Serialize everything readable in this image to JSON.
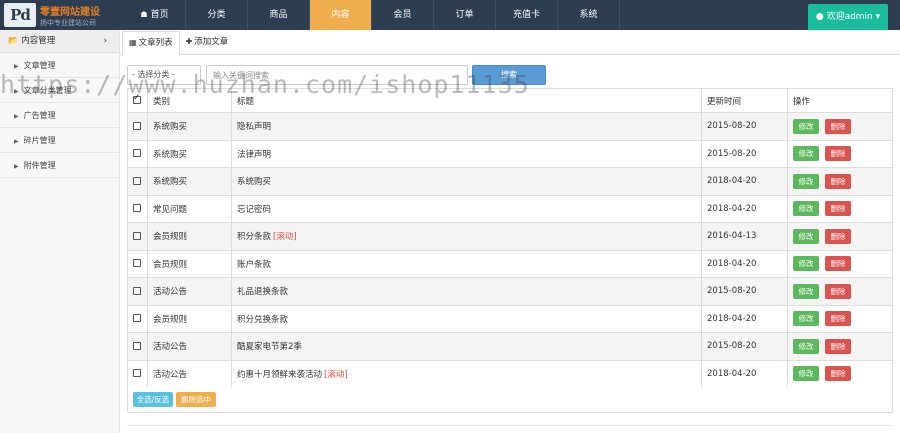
{
  "logo": {
    "mark": "Pd",
    "title": "零壹网站建设",
    "subtitle": "扬中专业建站公司"
  },
  "nav": [
    {
      "label": "首页",
      "icon": "home-icon",
      "active": false
    },
    {
      "label": "分类",
      "active": false
    },
    {
      "label": "商品",
      "active": false
    },
    {
      "label": "内容",
      "active": true
    },
    {
      "label": "会员",
      "active": false
    },
    {
      "label": "订单",
      "active": false
    },
    {
      "label": "充值卡",
      "active": false
    },
    {
      "label": "系统",
      "active": false
    }
  ],
  "user_menu": {
    "label": "欢迎admin",
    "icon": "user-icon"
  },
  "sidebar": {
    "header": "内容管理",
    "items": [
      "文章管理",
      "文章分类管理",
      "广告管理",
      "碎片管理",
      "附件管理"
    ]
  },
  "tabs": {
    "list": "文章列表",
    "add": "添加文章"
  },
  "search": {
    "category_placeholder": "选择分类",
    "keyword_placeholder": "输入关键词搜索",
    "button": "搜索"
  },
  "table": {
    "headers": {
      "category": "类别",
      "title": "标题",
      "updated": "更新时间",
      "actions": "操作"
    },
    "edit_label": "修改",
    "delete_label": "删除",
    "rows": [
      {
        "category": "系统购买",
        "title": "隐私声明",
        "tag": "",
        "date": "2015-08-20"
      },
      {
        "category": "系统购买",
        "title": "法律声明",
        "tag": "",
        "date": "2015-08-20"
      },
      {
        "category": "系统购买",
        "title": "系统购买",
        "tag": "",
        "date": "2018-04-20"
      },
      {
        "category": "常见问题",
        "title": "忘记密码",
        "tag": "",
        "date": "2018-04-20"
      },
      {
        "category": "会员规则",
        "title": "积分条款",
        "tag": "[滚动]",
        "date": "2016-04-13"
      },
      {
        "category": "会员规则",
        "title": "账户条款",
        "tag": "",
        "date": "2018-04-20"
      },
      {
        "category": "活动公告",
        "title": "礼品退换条款",
        "tag": "",
        "date": "2015-08-20"
      },
      {
        "category": "会员规则",
        "title": "积分兑换条款",
        "tag": "",
        "date": "2018-04-20"
      },
      {
        "category": "活动公告",
        "title": "酷夏家电节第2季",
        "tag": "",
        "date": "2015-08-20"
      },
      {
        "category": "活动公告",
        "title": "约惠十月领鲜来袭活动",
        "tag": "[滚动]",
        "date": "2018-04-20"
      }
    ]
  },
  "footer": {
    "select_all": "全选/反选",
    "delete_selected": "删除选中"
  },
  "watermark": "https://www.huzhan.com/ishop11135",
  "colors": {
    "topbar": "#2d3e50",
    "active_nav": "#f0ad4e",
    "user_button": "#1abc9c",
    "edit": "#5cb85c",
    "delete": "#d9534f"
  }
}
